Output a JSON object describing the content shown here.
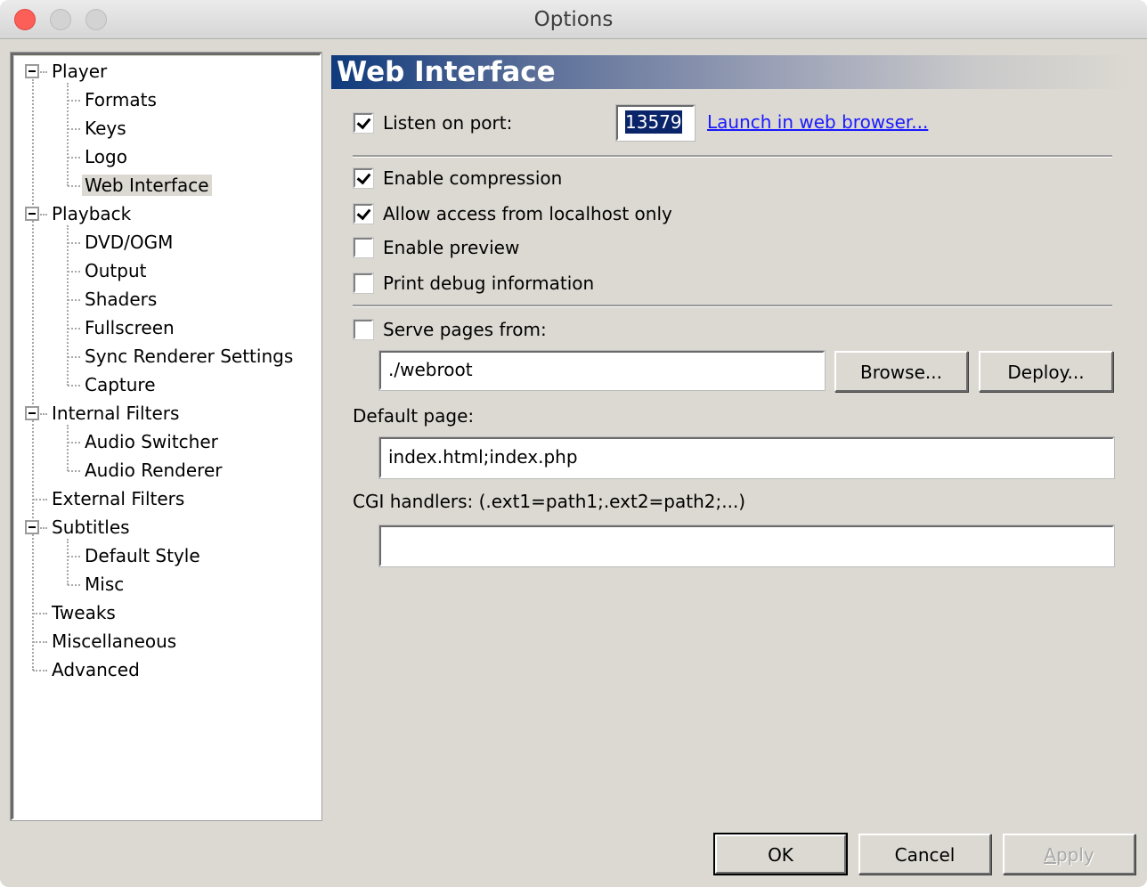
{
  "window": {
    "title": "Options"
  },
  "tree": {
    "nodes": [
      {
        "label": "Player",
        "level": 0,
        "expandable": true
      },
      {
        "label": "Formats",
        "level": 1
      },
      {
        "label": "Keys",
        "level": 1
      },
      {
        "label": "Logo",
        "level": 1
      },
      {
        "label": "Web Interface",
        "level": 1,
        "selected": true
      },
      {
        "label": "Playback",
        "level": 0,
        "expandable": true
      },
      {
        "label": "DVD/OGM",
        "level": 1
      },
      {
        "label": "Output",
        "level": 1
      },
      {
        "label": "Shaders",
        "level": 1
      },
      {
        "label": "Fullscreen",
        "level": 1
      },
      {
        "label": "Sync Renderer Settings",
        "level": 1
      },
      {
        "label": "Capture",
        "level": 1
      },
      {
        "label": "Internal Filters",
        "level": 0,
        "expandable": true
      },
      {
        "label": "Audio Switcher",
        "level": 1
      },
      {
        "label": "Audio Renderer",
        "level": 1
      },
      {
        "label": "External Filters",
        "level": 0
      },
      {
        "label": "Subtitles",
        "level": 0,
        "expandable": true
      },
      {
        "label": "Default Style",
        "level": 1
      },
      {
        "label": "Misc",
        "level": 1
      },
      {
        "label": "Tweaks",
        "level": 0
      },
      {
        "label": "Miscellaneous",
        "level": 0
      },
      {
        "label": "Advanced",
        "level": 0
      }
    ]
  },
  "page": {
    "header": "Web Interface",
    "listen_on_port": {
      "label": "Listen on port:",
      "checked": true
    },
    "port_value": "13579",
    "launch_link": "Launch in web browser...",
    "options": [
      {
        "label": "Enable compression",
        "checked": true
      },
      {
        "label": "Allow access from localhost only",
        "checked": true
      },
      {
        "label": "Enable preview",
        "checked": false
      },
      {
        "label": "Print debug information",
        "checked": false
      }
    ],
    "serve_pages": {
      "label": "Serve pages from:",
      "checked": false
    },
    "webroot_value": "./webroot",
    "browse_label": "Browse...",
    "deploy_label": "Deploy...",
    "default_page_label": "Default page:",
    "default_page_value": "index.html;index.php",
    "cgi_label": "CGI handlers: (.ext1=path1;.ext2=path2;...)",
    "cgi_value": ""
  },
  "footer": {
    "ok_label": "OK",
    "cancel_label": "Cancel",
    "apply_accel": "A",
    "apply_rest": "pply"
  },
  "colors": {
    "header_start": "#0f3a7c",
    "link": "#1a1aff",
    "selection": "#0a246a"
  }
}
